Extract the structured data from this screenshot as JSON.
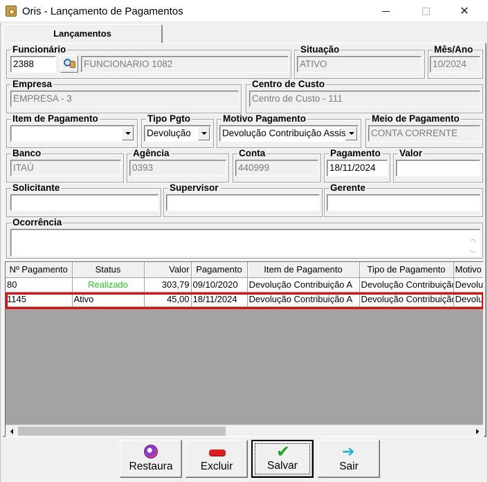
{
  "window": {
    "title": "Oris - Lançamento de Pagamentos"
  },
  "tab": {
    "label": "Lançamentos"
  },
  "form": {
    "funcionario": {
      "label": "Funcionário",
      "code": "2388",
      "name": "FUNCIONARIO 1082"
    },
    "situacao": {
      "label": "Situação",
      "value": "ATIVO"
    },
    "mes_ano": {
      "label": "Mês/Ano",
      "value": "10/2024"
    },
    "empresa": {
      "label": "Empresa",
      "value": "EMPRESA - 3"
    },
    "centro_custo": {
      "label": "Centro de Custo",
      "value": "Centro de Custo - 111"
    },
    "item_pagamento": {
      "label": "Item de Pagamento",
      "value": ""
    },
    "tipo_pgto": {
      "label": "Tipo Pgto",
      "value": "Devolução"
    },
    "motivo_pagamento": {
      "label": "Motivo Pagamento",
      "value": "Devolução Contribuição Assis"
    },
    "meio_pagamento": {
      "label": "Meio de Pagamento",
      "value": "CONTA CORRENTE"
    },
    "banco": {
      "label": "Banco",
      "value": "ITAÚ"
    },
    "agencia": {
      "label": "Agência",
      "value": "0393"
    },
    "conta": {
      "label": "Conta",
      "value": "440999"
    },
    "pagamento": {
      "label": "Pagamento",
      "value": "18/11/2024"
    },
    "valor": {
      "label": "Valor",
      "value": ""
    },
    "solicitante": {
      "label": "Solicitante",
      "value": ""
    },
    "supervisor": {
      "label": "Supervisor",
      "value": ""
    },
    "gerente": {
      "label": "Gerente",
      "value": ""
    },
    "ocorrencia": {
      "label": "Ocorrência",
      "value": ""
    }
  },
  "grid": {
    "columns": [
      "Nº Pagamento",
      "Status",
      "Valor",
      "Pagamento",
      "Item de Pagamento",
      "Tipo de Pagamento",
      "Motivo"
    ],
    "rows": [
      [
        "80",
        "Realizado",
        "303,79",
        "09/10/2020",
        "Devolução Contribuição A",
        "Devolução Contribuição",
        "Devolução"
      ],
      [
        "1145",
        "Ativo",
        "45,00",
        "18/11/2024",
        "Devolução Contribuição A",
        "Devolução Contribuição",
        "Devolução"
      ]
    ],
    "colors": {
      "realizado": "#22cc22",
      "highlight": "#e01010"
    }
  },
  "buttons": {
    "restaura": "Restaura",
    "excluir": "Excluir",
    "salvar": "Salvar",
    "sair": "Sair"
  },
  "icons": {
    "restaura": "restore-icon",
    "excluir": "delete-icon",
    "salvar": "checkmark-icon",
    "sair": "exit-arrow-icon"
  }
}
